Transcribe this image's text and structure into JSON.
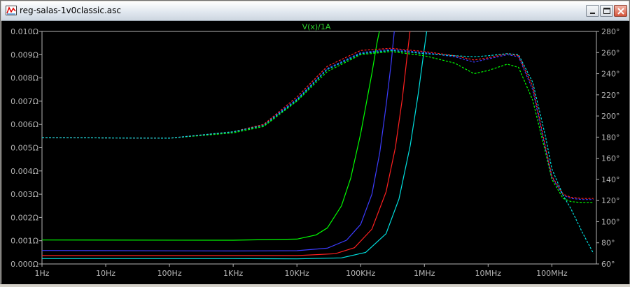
{
  "window": {
    "title": "reg-salas-1v0classic.asc",
    "icon": "waveform-app-icon",
    "buttons": [
      "minimize-icon",
      "maximize-icon",
      "close-icon"
    ]
  },
  "chart_data": {
    "type": "line",
    "title": "V(x)/1A",
    "title_color": "#2fd42f",
    "background": "#000000",
    "axis_color": "#b4b4b4",
    "grid": false,
    "x_scale": "log",
    "xlim_hz": [
      1,
      500000000
    ],
    "x_ticks": [
      {
        "label": "1Hz",
        "hz": 1
      },
      {
        "label": "10Hz",
        "hz": 10
      },
      {
        "label": "100Hz",
        "hz": 100
      },
      {
        "label": "1KHz",
        "hz": 1000
      },
      {
        "label": "10KHz",
        "hz": 10000
      },
      {
        "label": "100KHz",
        "hz": 100000
      },
      {
        "label": "1MHz",
        "hz": 1000000
      },
      {
        "label": "10MHz",
        "hz": 10000000
      },
      {
        "label": "100MHz",
        "hz": 100000000
      }
    ],
    "y_left": {
      "unit": "ohm",
      "lim": [
        0,
        0.01
      ],
      "ticks": [
        {
          "label": "0.000Ω",
          "v": 0
        },
        {
          "label": "0.001Ω",
          "v": 0.001
        },
        {
          "label": "0.002Ω",
          "v": 0.002
        },
        {
          "label": "0.003Ω",
          "v": 0.003
        },
        {
          "label": "0.004Ω",
          "v": 0.004
        },
        {
          "label": "0.005Ω",
          "v": 0.005
        },
        {
          "label": "0.006Ω",
          "v": 0.006
        },
        {
          "label": "0.007Ω",
          "v": 0.007
        },
        {
          "label": "0.008Ω",
          "v": 0.008
        },
        {
          "label": "0.009Ω",
          "v": 0.009
        },
        {
          "label": "0.010Ω",
          "v": 0.01
        }
      ]
    },
    "y_right": {
      "unit": "degree",
      "lim": [
        60,
        280
      ],
      "ticks": [
        {
          "label": "60°",
          "v": 60
        },
        {
          "label": "80°",
          "v": 80
        },
        {
          "label": "100°",
          "v": 100
        },
        {
          "label": "120°",
          "v": 120
        },
        {
          "label": "140°",
          "v": 140
        },
        {
          "label": "160°",
          "v": 160
        },
        {
          "label": "180°",
          "v": 180
        },
        {
          "label": "200°",
          "v": 200
        },
        {
          "label": "220°",
          "v": 220
        },
        {
          "label": "240°",
          "v": 240
        },
        {
          "label": "260°",
          "v": 260
        },
        {
          "label": "280°",
          "v": 280
        }
      ]
    },
    "series": [
      {
        "color": "#00ff00",
        "kind": "magnitude",
        "axis": "left",
        "points": [
          [
            1,
            0.00103
          ],
          [
            1000,
            0.00102
          ],
          [
            10000,
            0.00107
          ],
          [
            20000,
            0.00125
          ],
          [
            30000,
            0.00155
          ],
          [
            50000,
            0.0025
          ],
          [
            70000,
            0.0037
          ],
          [
            100000,
            0.0056
          ],
          [
            150000,
            0.0082
          ],
          [
            180000,
            0.0095
          ],
          [
            200000,
            0.0101
          ]
        ]
      },
      {
        "color": "#3c3cff",
        "kind": "magnitude",
        "axis": "left",
        "points": [
          [
            1,
            0.00058
          ],
          [
            1000,
            0.00056
          ],
          [
            10000,
            0.00057
          ],
          [
            30000,
            0.00068
          ],
          [
            60000,
            0.00102
          ],
          [
            100000,
            0.0017
          ],
          [
            150000,
            0.003
          ],
          [
            200000,
            0.0048
          ],
          [
            250000,
            0.0068
          ],
          [
            300000,
            0.0086
          ],
          [
            340000,
            0.0101
          ]
        ]
      },
      {
        "color": "#ff2020",
        "kind": "magnitude",
        "axis": "left",
        "points": [
          [
            1,
            0.00036
          ],
          [
            1000,
            0.00036
          ],
          [
            10000,
            0.00036
          ],
          [
            40000,
            0.00044
          ],
          [
            80000,
            0.0007
          ],
          [
            150000,
            0.0015
          ],
          [
            250000,
            0.0031
          ],
          [
            350000,
            0.005
          ],
          [
            450000,
            0.0071
          ],
          [
            550000,
            0.0092
          ],
          [
            600000,
            0.0101
          ]
        ]
      },
      {
        "color": "#00e0e0",
        "kind": "magnitude",
        "axis": "left",
        "points": [
          [
            1,
            0.00023
          ],
          [
            1000,
            0.00023
          ],
          [
            10000,
            0.00022
          ],
          [
            50000,
            0.00026
          ],
          [
            120000,
            0.0005
          ],
          [
            250000,
            0.0013
          ],
          [
            400000,
            0.0028
          ],
          [
            600000,
            0.0051
          ],
          [
            800000,
            0.0073
          ],
          [
            1000000,
            0.0093
          ],
          [
            1100000,
            0.0101
          ]
        ]
      },
      {
        "color": "#00ff00",
        "kind": "phase",
        "axis": "right",
        "dashed": true,
        "points": [
          [
            1,
            179.5
          ],
          [
            100,
            179
          ],
          [
            1000,
            184
          ],
          [
            3000,
            190
          ],
          [
            10000,
            214
          ],
          [
            30000,
            242
          ],
          [
            100000,
            258
          ],
          [
            300000,
            261
          ],
          [
            1000000,
            257
          ],
          [
            3000000,
            250
          ],
          [
            6000000,
            240
          ],
          [
            10000000,
            243
          ],
          [
            20000000,
            249
          ],
          [
            30000000,
            246
          ],
          [
            50000000,
            215
          ],
          [
            80000000,
            165
          ],
          [
            100000000,
            140
          ],
          [
            150000000,
            122
          ],
          [
            200000000,
            119
          ],
          [
            300000000,
            118
          ],
          [
            450000000,
            118
          ]
        ]
      },
      {
        "color": "#3c3cff",
        "kind": "phase",
        "axis": "right",
        "dashed": true,
        "points": [
          [
            1,
            179.5
          ],
          [
            100,
            179
          ],
          [
            1000,
            185
          ],
          [
            3000,
            192
          ],
          [
            10000,
            216
          ],
          [
            30000,
            245
          ],
          [
            100000,
            260
          ],
          [
            300000,
            263
          ],
          [
            1000000,
            260
          ],
          [
            3000000,
            256
          ],
          [
            6000000,
            251
          ],
          [
            10000000,
            254
          ],
          [
            20000000,
            258
          ],
          [
            30000000,
            256
          ],
          [
            50000000,
            225
          ],
          [
            80000000,
            168
          ],
          [
            100000000,
            142
          ],
          [
            150000000,
            125
          ],
          [
            200000000,
            122
          ],
          [
            300000000,
            121
          ],
          [
            450000000,
            121
          ]
        ]
      },
      {
        "color": "#ff2020",
        "kind": "phase",
        "axis": "right",
        "dashed": true,
        "points": [
          [
            1,
            179.5
          ],
          [
            100,
            179
          ],
          [
            1000,
            185
          ],
          [
            3000,
            192
          ],
          [
            10000,
            218
          ],
          [
            30000,
            247
          ],
          [
            100000,
            262
          ],
          [
            300000,
            264
          ],
          [
            1000000,
            261
          ],
          [
            3000000,
            257
          ],
          [
            6000000,
            253
          ],
          [
            10000000,
            255
          ],
          [
            20000000,
            259
          ],
          [
            30000000,
            257
          ],
          [
            50000000,
            228
          ],
          [
            80000000,
            170
          ],
          [
            100000000,
            143
          ],
          [
            150000000,
            126
          ],
          [
            200000000,
            123
          ],
          [
            300000000,
            122
          ],
          [
            450000000,
            122
          ]
        ]
      },
      {
        "color": "#00e0e0",
        "kind": "phase",
        "axis": "right",
        "dashed": true,
        "points": [
          [
            1,
            179.5
          ],
          [
            100,
            179
          ],
          [
            1000,
            185
          ],
          [
            3000,
            191
          ],
          [
            10000,
            215
          ],
          [
            30000,
            244
          ],
          [
            100000,
            259
          ],
          [
            300000,
            262
          ],
          [
            1000000,
            259
          ],
          [
            3000000,
            257
          ],
          [
            6000000,
            256
          ],
          [
            10000000,
            257
          ],
          [
            20000000,
            259
          ],
          [
            30000000,
            258
          ],
          [
            50000000,
            232
          ],
          [
            80000000,
            180
          ],
          [
            100000000,
            150
          ],
          [
            150000000,
            125
          ],
          [
            200000000,
            112
          ],
          [
            300000000,
            90
          ],
          [
            450000000,
            70
          ]
        ]
      }
    ]
  }
}
